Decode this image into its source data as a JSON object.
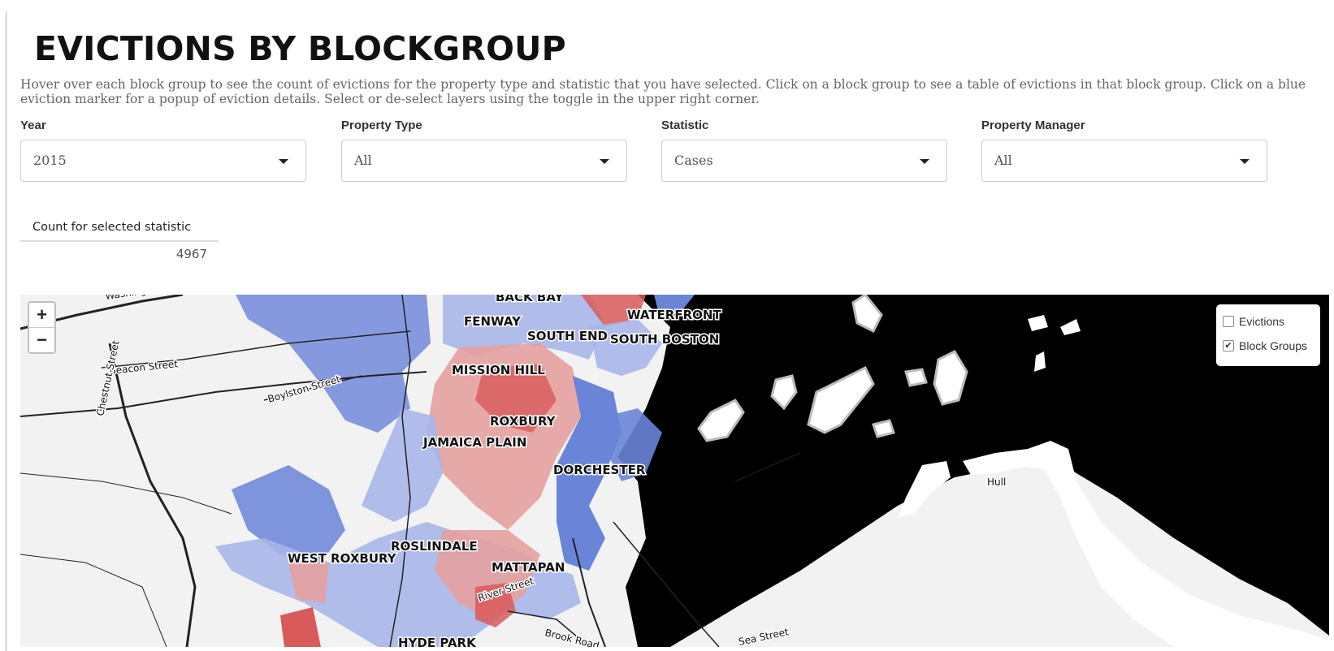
{
  "page": {
    "title": "EVICTIONS BY BLOCKGROUP",
    "description": "Hover over each block group to see the count of evictions for the property type and statistic that you have selected. Click on a block group to see a table of evictions in that block group. Click on a blue eviction marker for a popup of eviction details. Select or de-select layers using the toggle in the upper right corner."
  },
  "filters": [
    {
      "label": "Year",
      "value": "2015"
    },
    {
      "label": "Property Type",
      "value": "All"
    },
    {
      "label": "Statistic",
      "value": "Cases"
    },
    {
      "label": "Property Manager",
      "value": "All"
    }
  ],
  "count": {
    "header": "Count for selected statistic",
    "value": "4967"
  },
  "map": {
    "zoom_in": "+",
    "zoom_out": "−",
    "layers": [
      {
        "label": "Evictions",
        "checked": false
      },
      {
        "label": "Block Groups",
        "checked": true
      }
    ],
    "neighborhoods": [
      "BACK BAY",
      "FENWAY",
      "WATERFRONT",
      "SOUTH END",
      "SOUTH BOSTON",
      "MISSION HILL",
      "ROXBURY",
      "JAMAICA PLAIN",
      "DORCHESTER",
      "ROSLINDALE",
      "WEST ROXBURY",
      "MATTAPAN",
      "HYDE PARK"
    ],
    "streets": [
      "Washington",
      "Beacon Street",
      "Chestnut Street",
      "Boylston Street",
      "Brook Road",
      "Sea Street",
      "River Street"
    ],
    "places": [
      "Hull"
    ],
    "colors": {
      "high": "#d95a5a",
      "mid_high": "#e6a0a0",
      "mid_low": "#a8b6e8",
      "low": "#6a84d8",
      "water": "#000000",
      "land": "#f2f2f2"
    }
  }
}
